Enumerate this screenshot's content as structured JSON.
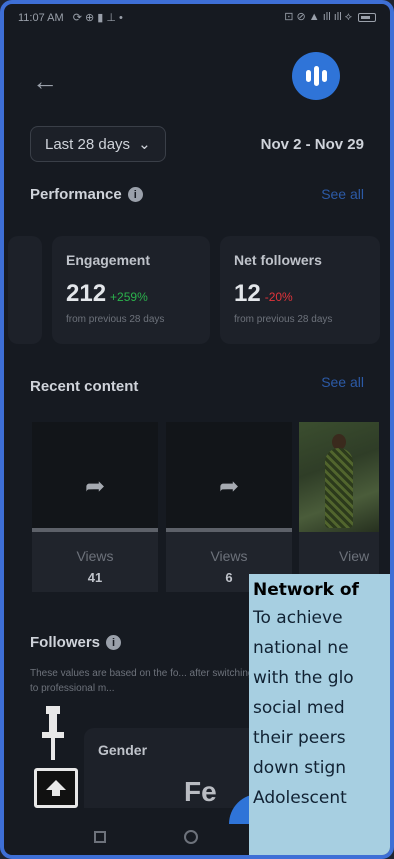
{
  "status_bar": {
    "time": "11:07 AM",
    "left_icons": "⟳ ⊕ ▮ ⊥ •",
    "right_icons": "⊡ ⊘ ▲ ıll ıll ⟡"
  },
  "header": {
    "period_label": "Last 28 days",
    "date_range": "Nov 2 - Nov 29"
  },
  "performance": {
    "title": "Performance",
    "see_all": "See all",
    "cards": [
      {
        "label": "Engagement",
        "value": "212",
        "change": "+259%",
        "change_color": "#2bb24c",
        "sub": "from previous 28 days"
      },
      {
        "label": "Net followers",
        "value": "12",
        "change": "-20%",
        "change_color": "#e0343a",
        "sub": "from previous 28 days"
      }
    ]
  },
  "recent_content": {
    "title": "Recent content",
    "see_all": "See all",
    "items": [
      {
        "views_label": "Views",
        "views": "41"
      },
      {
        "views_label": "Views",
        "views": "6"
      },
      {
        "views_label": "View",
        "views": ""
      }
    ]
  },
  "followers": {
    "title": "Followers",
    "note": "These values are based on the fo... after switching to professional m..."
  },
  "gender": {
    "label": "Gender"
  },
  "overlay_fe": "Fe",
  "overlay": {
    "title": "Network of",
    "lines": [
      "To achieve",
      "national ne",
      "with the glo",
      "social med",
      "their peers",
      "down stign",
      "Adolescent"
    ]
  },
  "colors": {
    "accent": "#2f74d8",
    "frame": "#3e6fd6",
    "positive": "#2bb24c",
    "negative": "#e0343a"
  }
}
